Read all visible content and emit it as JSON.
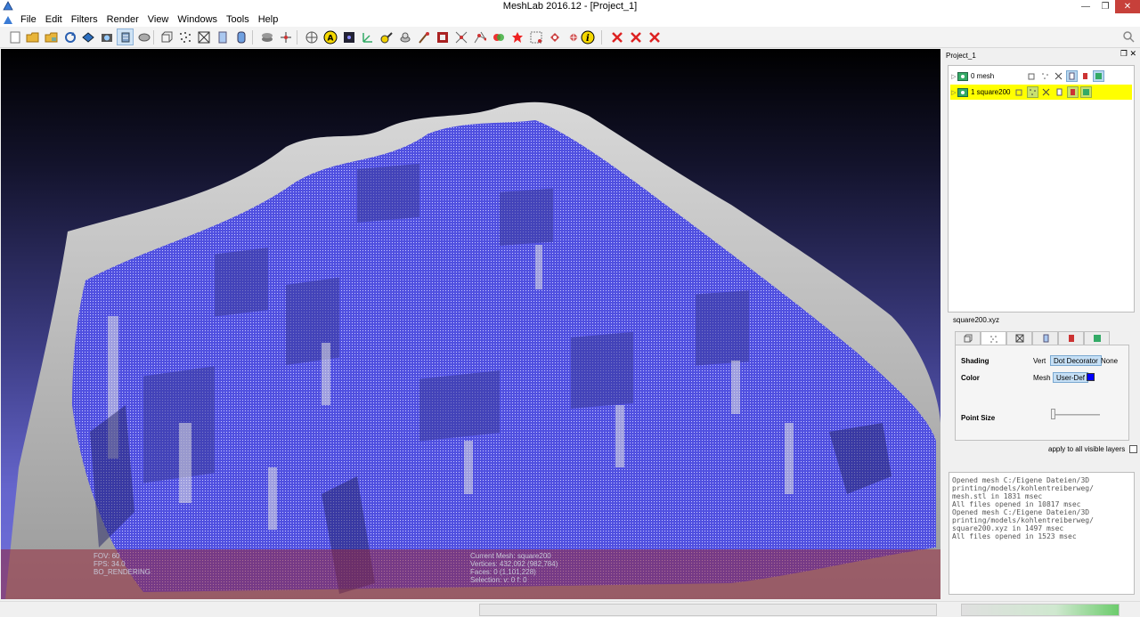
{
  "window": {
    "title": "MeshLab 2016.12 - [Project_1]",
    "minimize_icon": "minimize-icon",
    "restore_icon": "restore-icon",
    "close_icon": "close-icon"
  },
  "menu": {
    "items": [
      "File",
      "Edit",
      "Filters",
      "Render",
      "View",
      "Windows",
      "Tools",
      "Help"
    ]
  },
  "toolbar": {
    "icons": [
      "new-project-icon",
      "open-project-icon",
      "open-mesh-icon",
      "reload-icon",
      "save-icon",
      "snapshot-icon",
      "layers-icon",
      "show-raster-icon",
      "bbox-icon",
      "points-icon",
      "wireframe-icon",
      "flat-icon",
      "smooth-icon",
      "light-icon",
      "trackball-icon",
      "annotation-icon",
      "shader-icon",
      "measure-icon",
      "pick-points-icon",
      "paint-icon",
      "brush-icon",
      "texture-icon",
      "select-faces-icon",
      "select-vertices-icon",
      "select-connected-icon",
      "align-icon",
      "color-picker-icon",
      "select-raster-icon",
      "manipulator-icon",
      "info-icon",
      "delete-faces-icon",
      "delete-vertices-icon",
      "delete-selection-icon"
    ]
  },
  "viewport": {
    "info_left": [
      "FOV: 60",
      "FPS:   34.0",
      "BO_RENDERING"
    ],
    "info_center": [
      "Current Mesh: square200",
      "Vertices: 432,092    (982,784)",
      "Faces: 0    (1,101,228)",
      "Selection: v: 0 f: 0"
    ]
  },
  "layers_panel": {
    "title": "Project_1",
    "float_icon": "float-icon",
    "close_icon": "close-icon",
    "layers": [
      {
        "name": "0  mesh",
        "selected": false
      },
      {
        "name": "1  square200",
        "selected": true
      }
    ]
  },
  "decorator": {
    "title": "square200.xyz",
    "tabs": [
      "bbox-tab",
      "points-tab",
      "wire-tab",
      "flat-tab",
      "smooth-tab",
      "texture-tab"
    ],
    "shading_label": "Shading",
    "shading_options": [
      "Vert",
      "Dot Decorator",
      "None"
    ],
    "color_label": "Color",
    "color_options": [
      "Mesh",
      "User-Def"
    ],
    "color_value": "#0000ff",
    "point_size_label": "Point Size",
    "point_size_level": 0.0,
    "apply_label": "apply to all visible layers"
  },
  "log": {
    "text": "Opened mesh C:/Eigene Dateien/3D\nprinting/models/kohlentreiberweg/\nmesh.stl in 1831 msec\nAll files opened in 10817 msec\nOpened mesh C:/Eigene Dateien/3D\nprinting/models/kohlentreiberweg/\nsquare200.xyz in 1497 msec\nAll files opened in 1523 msec"
  },
  "status": {
    "progress": 1.0
  },
  "colors": {
    "accent_blue": "#0000ff",
    "selected_row": "#ffff00",
    "info_overlay": "#96283c"
  }
}
